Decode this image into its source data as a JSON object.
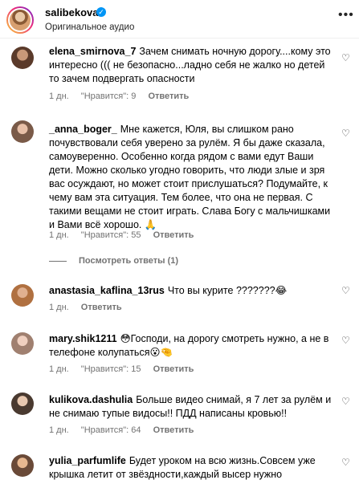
{
  "post": {
    "username": "salibekova",
    "audio": "Оригинальное аудио",
    "more_icon": "more-horizontal-icon",
    "verified_icon": "verified-badge-icon"
  },
  "comments": [
    {
      "username": "elena_smirnova_7",
      "text": "Зачем снимать ночную дорогу....кому это интересно ((( не безопасно...ладно себя не жалко но детей то зачем подвергать опасности",
      "time": "1 дн.",
      "likes": "\"Нравится\": 9",
      "reply": "Ответить"
    },
    {
      "username": "_anna_boger_",
      "text": "Мне кажется, Юля, вы слишком рано почувствовали себя уверено за рулём. Я бы даже сказала, самоуверенно. Особенно когда рядом с вами едут Ваши дети. Можно сколько угодно говорить, что люди злые и зря вас осуждают, но может стоит прислушаться? Подумайте, к чему вам эта ситуация. Тем более, что она не первая. С такими вещами не стоит играть. Слава Богу с мальчишками и Вами всё хорошо. 🙏",
      "time": "1 дн.",
      "likes": "\"Нравится\": 55",
      "reply": "Ответить",
      "view_replies": "Посмотреть ответы (1)"
    },
    {
      "username": "anastasia_kaflina_13rus",
      "text": "Что вы курите ???????😂",
      "time": "1 дн.",
      "likes": "",
      "reply": "Ответить"
    },
    {
      "username": "mary.shik1211",
      "text": "😳Господи, на дорогу смотреть нужно, а не в телефоне колупаться😮🤏",
      "time": "1 дн.",
      "likes": "\"Нравится\": 15",
      "reply": "Ответить"
    },
    {
      "username": "kulikova.dashulia",
      "text": "Больше видео снимай, я 7 лет за рулём и не снимаю тупые видосы!! ПДД написаны кровью!!",
      "time": "1 дн.",
      "likes": "\"Нравится\": 64",
      "reply": "Ответить"
    },
    {
      "username": "yulia_parfumlife",
      "text": "Будет уроком на всю жизнь.Совсем уже крышка летит от звёздности,каждый высер нужно",
      "time": "",
      "likes": "",
      "reply": ""
    }
  ],
  "icons": {
    "like": "heart-outline-icon"
  }
}
